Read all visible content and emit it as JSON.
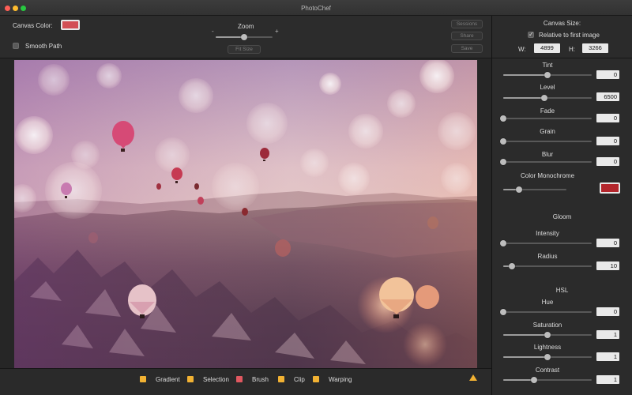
{
  "window": {
    "title": "PhotoChef"
  },
  "toolbar": {
    "canvas_color_label": "Canvas Color:",
    "canvas_color": "#d24f55",
    "smooth_path_label": "Smooth Path",
    "smooth_path_checked": false,
    "zoom_label": "Zoom",
    "zoom_minus": "-",
    "zoom_plus": "+",
    "zoom_level": 0.5,
    "fit_size_label": "Fit Size",
    "sessions_label": "Sessions",
    "share_label": "Share",
    "save_label": "Save"
  },
  "canvas_size": {
    "title": "Canvas Size:",
    "relative_label": "Relative to first image",
    "relative_checked": true,
    "w_label": "W:",
    "w_value": "4899",
    "h_label": "H:",
    "h_value": "3266"
  },
  "adjustments": {
    "tint": {
      "label": "Tint",
      "value": "0",
      "level": 0.5
    },
    "level": {
      "label": "Level",
      "value": "6500",
      "level": 0.46
    },
    "fade": {
      "label": "Fade",
      "value": "0",
      "level": 0.0
    },
    "grain": {
      "label": "Grain",
      "value": "0",
      "level": 0.0
    },
    "blur": {
      "label": "Blur",
      "value": "0",
      "level": 0.0
    },
    "color_monochrome": {
      "label": "Color Monochrome",
      "level": 0.25,
      "color": "#b3262c"
    }
  },
  "gloom": {
    "title": "Gloom",
    "intensity": {
      "label": "Intensity",
      "value": "0",
      "level": 0.0
    },
    "radius": {
      "label": "Radius",
      "value": "10",
      "level": 0.1
    }
  },
  "hsl": {
    "title": "HSL",
    "hue": {
      "label": "Hue",
      "value": "0",
      "level": 0.0
    },
    "saturation": {
      "label": "Saturation",
      "value": "1",
      "level": 0.5
    },
    "lightness": {
      "label": "Lightness",
      "value": "1",
      "level": 0.5
    },
    "contrast": {
      "label": "Contrast",
      "value": "1",
      "level": 0.35
    }
  },
  "tools": [
    {
      "label": "Gradient",
      "color": "#f2b233"
    },
    {
      "label": "Selection",
      "color": "#f2b233"
    },
    {
      "label": "Brush",
      "color": "#e05860"
    },
    {
      "label": "Clip",
      "color": "#f2b233"
    },
    {
      "label": "Warping",
      "color": "#f2b233"
    }
  ]
}
